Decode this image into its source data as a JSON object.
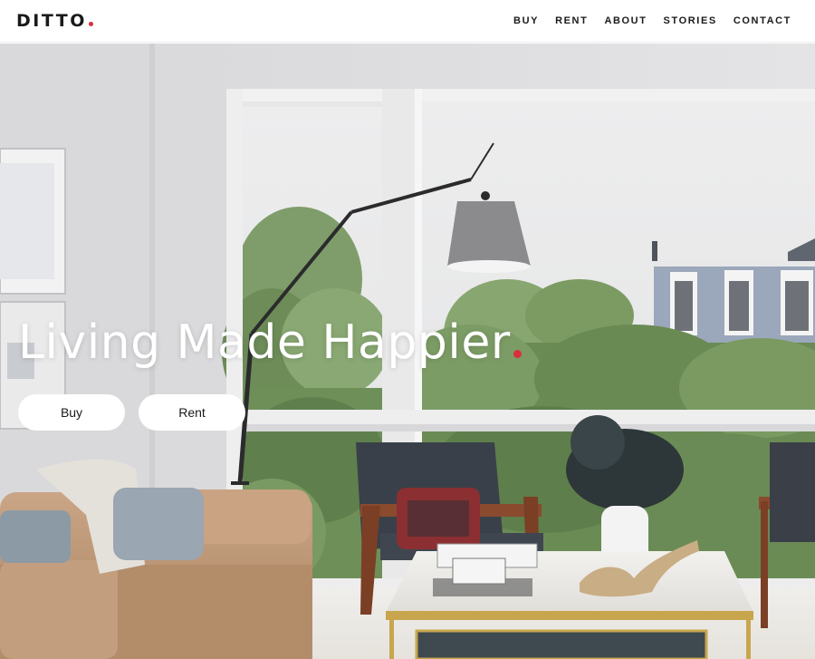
{
  "brand": {
    "name": "DITTO",
    "accent_color": "#d92f3c"
  },
  "nav": {
    "items": [
      {
        "label": "BUY"
      },
      {
        "label": "RENT"
      },
      {
        "label": "ABOUT"
      },
      {
        "label": "STORIES"
      },
      {
        "label": "CONTACT"
      }
    ]
  },
  "hero": {
    "title": "Living Made Happier",
    "buy_label": "Buy",
    "rent_label": "Rent",
    "image_description_icon": "living-room-photo"
  }
}
